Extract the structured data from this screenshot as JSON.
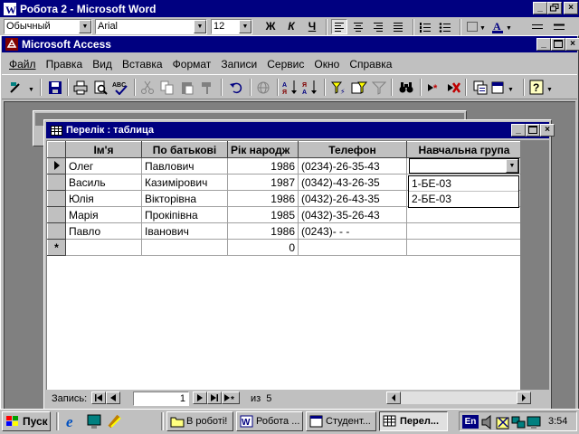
{
  "word": {
    "title": "Робота 2 - Microsoft Word",
    "style_value": "Обычный",
    "font_value": "Arial",
    "size_value": "12",
    "bold_label": "Ж",
    "italic_label": "К",
    "underline_label": "Ч"
  },
  "access": {
    "title": "Microsoft Access",
    "menu": [
      "Файл",
      "Правка",
      "Вид",
      "Вставка",
      "Формат",
      "Записи",
      "Сервис",
      "Окно",
      "Справка"
    ]
  },
  "table_window": {
    "title": "Перелік : таблица",
    "columns": [
      "Ім'я",
      "По батькові",
      "Рік народж",
      "Телефон",
      "Навчальна група"
    ],
    "rows": [
      [
        "Олег",
        "Павлович",
        "1986",
        "(0234)-26-35-43",
        ""
      ],
      [
        "Василь",
        "Казимірович",
        "1987",
        "(0342)-43-26-35",
        ""
      ],
      [
        "Юлія",
        "Вікторівна",
        "1986",
        "(0432)-26-43-35",
        ""
      ],
      [
        "Марія",
        "Прокіпівна",
        "1985",
        "(0432)-35-26-43",
        ""
      ],
      [
        "Павло",
        "Іванович",
        "1986",
        "(0243)-  -  -",
        ""
      ]
    ],
    "new_row_value": "0",
    "new_row_marker": "*",
    "dropdown_options": [
      "1-БЕ-03",
      "2-БЕ-03"
    ],
    "nav_label": "Запись:",
    "record_number": "1",
    "record_total": "из  5"
  },
  "taskbar": {
    "start_label": "Пуск",
    "buttons": [
      "В роботі!",
      "Робота ...",
      "Студент...",
      "Перел..."
    ],
    "language": "En",
    "clock": "3:54"
  },
  "colors": {
    "title_active": "#000080",
    "title_inactive": "#808080",
    "face": "#c0c0c0",
    "desktop": "#808080"
  }
}
